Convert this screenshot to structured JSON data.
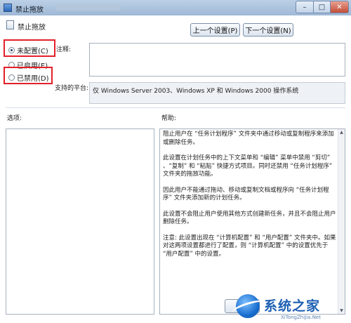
{
  "window": {
    "title": "禁止拖放",
    "minimize_glyph": "–",
    "maximize_glyph": "□",
    "close_glyph": "✕"
  },
  "policy": {
    "name": "禁止拖放"
  },
  "nav": {
    "prev_label": "上一个设置(P)",
    "next_label": "下一个设置(N)"
  },
  "state": {
    "options": [
      {
        "label": "未配置(C)",
        "checked": true
      },
      {
        "label": "已启用(E)",
        "checked": false
      },
      {
        "label": "已禁用(D)",
        "checked": false
      }
    ]
  },
  "fields": {
    "comment_label": "注释:",
    "comment_value": "",
    "platform_label": "支持的平台:",
    "platform_value": "仅 Windows Server 2003、Windows XP 和 Windows 2000 操作系统",
    "options_label": "选项:",
    "help_label": "帮助:"
  },
  "help": {
    "paragraphs": [
      "阻止用户在 “任务计划程序” 文件夹中通过移动或复制程序来添加或删除任务。",
      "此设置在计划任务中的上下文菜单和 “编辑” 菜单中禁用 “剪切” 、“复制” 和 “粘贴” 快捷方式项目。同时还禁用 “任务计划程序” 文件夹的拖放功能。",
      "因此用户不能通过拖动、移动或复制文档或程序向 “任务计划程序” 文件夹添加新的计划任务。",
      "此设置不会阻止用户使用其他方式创建新任务，并且不会阻止用户删除任务。",
      "注意: 此设置出现在 “计算机配置” 和 “用户配置” 文件夹中。如果对这两项设置都进行了配置，则 “计算机配置” 中的设置优先于 “用户配置” 中的设置。"
    ]
  },
  "watermark": {
    "text": "系统之家",
    "url": "XiTongZhiJia.Net"
  }
}
